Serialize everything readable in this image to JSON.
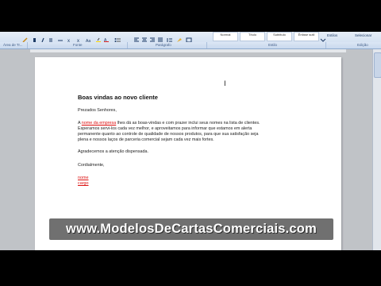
{
  "ribbon": {
    "styles": [
      "Normal",
      "Título",
      "Subtítulo",
      "Ênfase sutil"
    ],
    "edit": {
      "alterar_estilos": "Estilos",
      "selecionar": "Selecionar"
    }
  },
  "groups": {
    "area_transferencia": "Área de Tr...",
    "fonte": "Fonte",
    "paragrafo": "Parágrafo",
    "estilo": "Estilo",
    "edicao": "Edição"
  },
  "document": {
    "title": "Boas vindas ao novo cliente",
    "greeting": "Prezados Senhores,",
    "para1_prefix": "A ",
    "para1_red1": "nome da empresa",
    "para1_rest": " lhes dá as boas-vindas e com prazer inclui seus nomes na lista de clientes.",
    "para1_line2": "Esperamos servi-los cada vez melhor, e aproveitamos para informar que estamos em alerta",
    "para1_line3": "permanente quanto ao controle de qualidade de nossos produtos, para que sua satisfação seja",
    "para1_line4": "plena e nossos laços de parceria comercial sejam cada vez mais fortes.",
    "thanks": "Agradecemos a atenção dispensada.",
    "closing": "Cordialmente,",
    "sig_name": "nome",
    "sig_role": "cargo"
  },
  "watermark": "www.ModelosDeCartasComerciais.com"
}
